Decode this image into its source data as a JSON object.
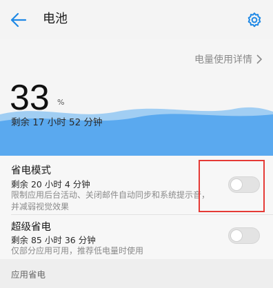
{
  "header": {
    "title": "电池",
    "back_icon": "arrow-left-icon",
    "settings_icon": "gear-icon",
    "accent_color": "#1e88e5"
  },
  "hero": {
    "details_link": "电量使用详情",
    "percent": "33",
    "percent_unit": "%",
    "remaining": "剩余 17 小时 52 分钟",
    "wave_color": "#5aa9ef"
  },
  "settings": {
    "power_saving": {
      "title": "省电模式",
      "subtitle": "剩余 20 小时 4 分钟",
      "description_line1": "限制应用后台活动、关闭邮件自动同步和系统提示音，",
      "description_line2": "并减弱视觉效果",
      "enabled": false
    },
    "ultra_saving": {
      "title": "超级省电",
      "subtitle": "剩余 85 小时 36 分钟",
      "description": "仅部分应用可用，推荐低电量时使用",
      "enabled": false
    }
  },
  "section": {
    "app_power_saving": "应用省电"
  }
}
